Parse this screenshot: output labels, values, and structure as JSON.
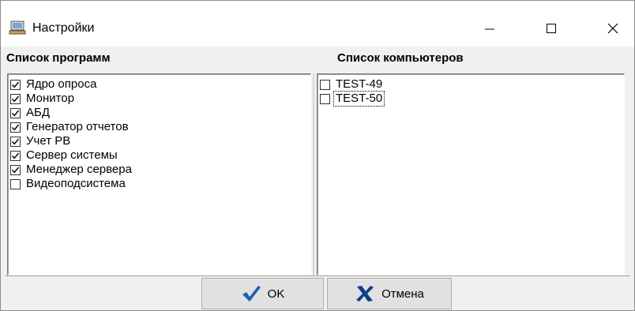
{
  "window": {
    "title": "Настройки",
    "controls": {
      "minimize": "—",
      "maximize": "☐",
      "close": "✕"
    }
  },
  "programs": {
    "header": "Список программ",
    "items": [
      {
        "label": "Ядро опроса",
        "checked": true
      },
      {
        "label": "Монитор",
        "checked": true
      },
      {
        "label": "АБД",
        "checked": true
      },
      {
        "label": "Генератор отчетов",
        "checked": true
      },
      {
        "label": "Учет РВ",
        "checked": true
      },
      {
        "label": "Сервер системы",
        "checked": true
      },
      {
        "label": "Менеджер сервера",
        "checked": true
      },
      {
        "label": "Видеоподсистема",
        "checked": false
      }
    ]
  },
  "computers": {
    "header": "Список компьютеров",
    "items": [
      {
        "label": "TEST-49",
        "checked": false,
        "focused": false
      },
      {
        "label": "TEST-50",
        "checked": false,
        "focused": true
      }
    ]
  },
  "buttons": {
    "ok_label": "OK",
    "cancel_label": "Отмена",
    "ok_icon": "checkmark-icon",
    "cancel_icon": "cross-icon",
    "ok_color": "#1c5fb5",
    "cancel_color": "#0d3f87"
  }
}
